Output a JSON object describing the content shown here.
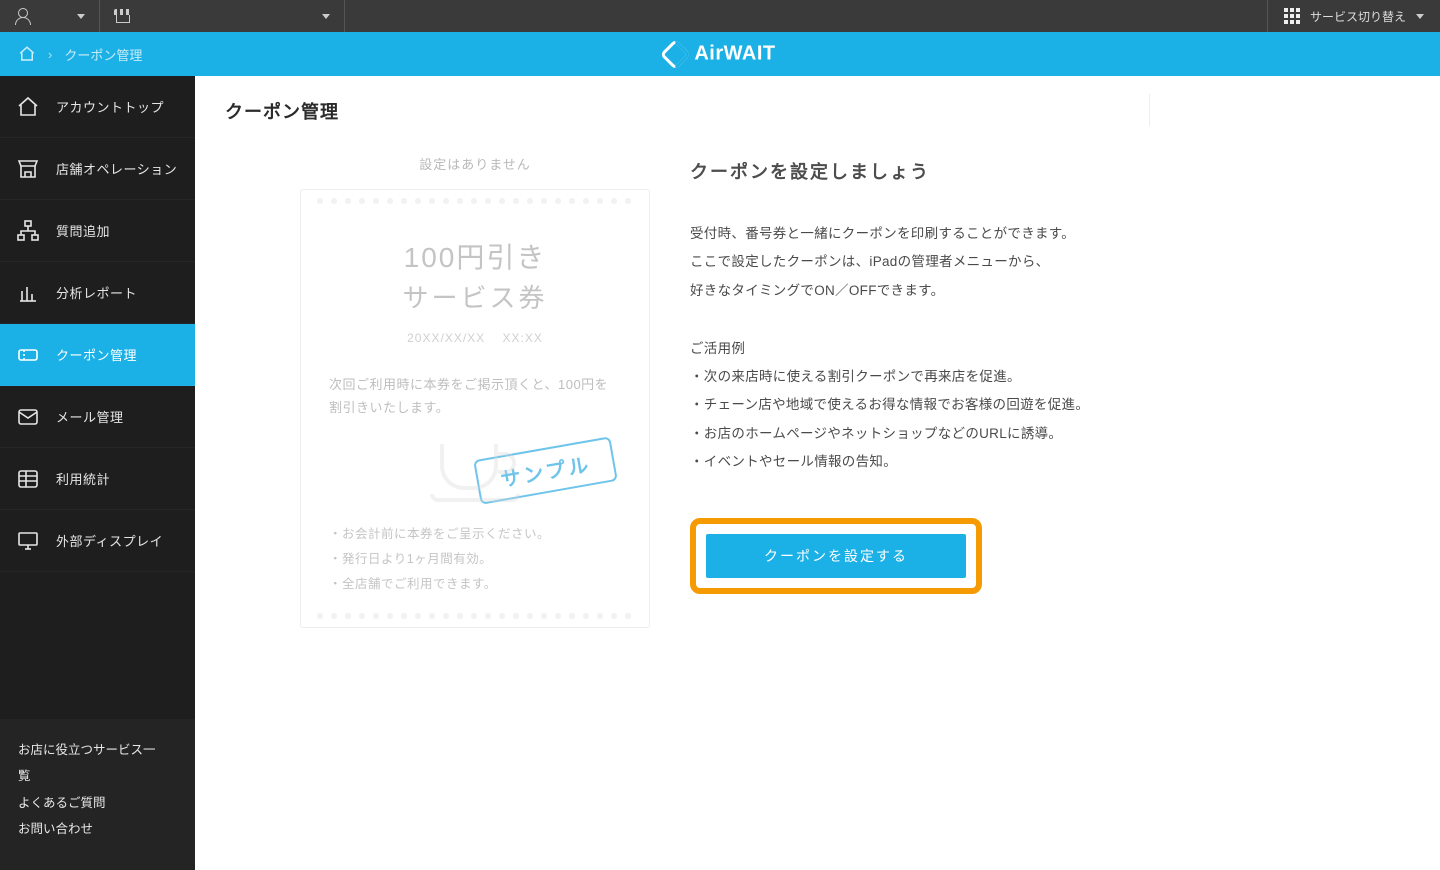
{
  "topbar": {
    "service_switch": "サービス切り替え"
  },
  "breadcrumb": {
    "current": "クーポン管理"
  },
  "brand": {
    "name": "AirWAIT"
  },
  "sidebar": {
    "items": [
      {
        "label": "アカウントトップ"
      },
      {
        "label": "店舗オペレーション"
      },
      {
        "label": "質問追加"
      },
      {
        "label": "分析レポート"
      },
      {
        "label": "クーポン管理"
      },
      {
        "label": "メール管理"
      },
      {
        "label": "利用統計"
      },
      {
        "label": "外部ディスプレイ"
      }
    ]
  },
  "footer": {
    "links": [
      "お店に役立つサービス一覧",
      "よくあるご質問",
      "お問い合わせ"
    ]
  },
  "page": {
    "title": "クーポン管理"
  },
  "sample": {
    "caption": "設定はありません",
    "big1": "100円引き",
    "big2": "サービス券",
    "date": "20XX/XX/XX",
    "time": "XX:XX",
    "desc": "次回ご利用時に本券をご掲示頂くと、100円を割引きいたします。",
    "stamp": "サンプル",
    "notes": [
      "・お会計前に本券をご呈示ください。",
      "・発行日より1ヶ月間有効。",
      "・全店舗でご利用できます。"
    ]
  },
  "right": {
    "heading": "クーポンを設定しましょう",
    "p1": "受付時、番号券と一緒にクーポンを印刷することができます。",
    "p2": "ここで設定したクーポンは、iPadの管理者メニューから、",
    "p3": "好きなタイミングでON／OFFできます。",
    "use_head": "ご活用例",
    "uses": [
      "・次の来店時に使える割引クーポンで再来店を促進。",
      "・チェーン店や地域で使えるお得な情報でお客様の回遊を促進。",
      "・お店のホームページやネットショップなどのURLに誘導。",
      "・イベントやセール情報の告知。"
    ],
    "cta": "クーポンを設定する"
  }
}
